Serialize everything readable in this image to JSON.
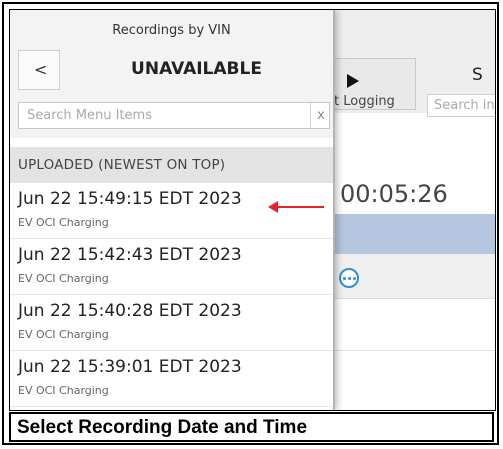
{
  "background_app": {
    "play_button_label": "t Logging",
    "search_placeholder": "Search in",
    "header_letter": "S",
    "elapsed_time": "00:05:26"
  },
  "panel": {
    "title": "Recordings by VIN",
    "back_label": "<",
    "vin_value": "UNAVAILABLE",
    "search": {
      "placeholder": "Search Menu Items",
      "value": "",
      "clear_label": "x"
    },
    "section_header": "UPLOADED (NEWEST ON TOP)",
    "recordings": [
      {
        "date": "Jun 22 15:49:15 EDT 2023",
        "type": "EV OCI Charging"
      },
      {
        "date": "Jun 22 15:42:43 EDT 2023",
        "type": "EV OCI Charging"
      },
      {
        "date": "Jun 22 15:40:28 EDT 2023",
        "type": "EV OCI Charging"
      },
      {
        "date": "Jun 22 15:39:01 EDT 2023",
        "type": "EV OCI Charging"
      }
    ]
  },
  "annotation": {
    "arrow_color": "#e8232a",
    "points_to": "first recording"
  },
  "caption": "Select Recording Date and Time",
  "colors": {
    "accent_blue": "#2d8fd5",
    "selected_band": "#b5c6e1",
    "section_header_bg": "#e3e3e3"
  },
  "icons": {
    "play": "play-icon",
    "more": "more-options-icon",
    "back": "chevron-left-icon",
    "clear": "close-icon",
    "arrow": "red-arrow-left-icon"
  }
}
